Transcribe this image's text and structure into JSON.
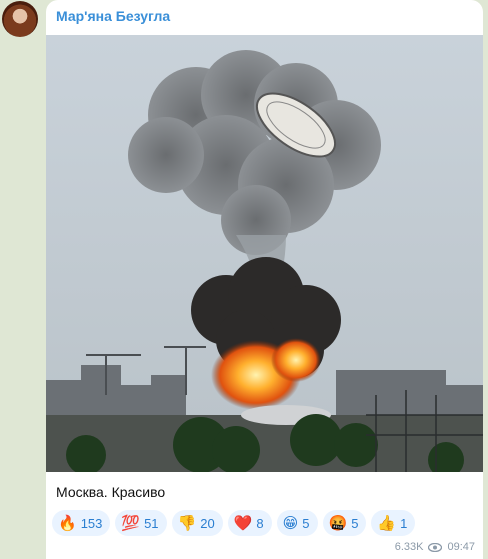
{
  "message": {
    "sender_name": "Мар'яна Безугла",
    "caption": "Москва. Красиво",
    "views": "6.33K",
    "time": "09:47"
  },
  "reactions": [
    {
      "emoji": "🔥",
      "count": "153"
    },
    {
      "emoji": "💯",
      "count": "51"
    },
    {
      "emoji": "👎",
      "count": "20"
    },
    {
      "emoji": "❤️",
      "count": "8"
    },
    {
      "emoji": "😁",
      "count": "5"
    },
    {
      "emoji": "🤬",
      "count": "5"
    },
    {
      "emoji": "👍",
      "count": "1"
    }
  ],
  "icons": {
    "views_icon": "eye-icon"
  }
}
